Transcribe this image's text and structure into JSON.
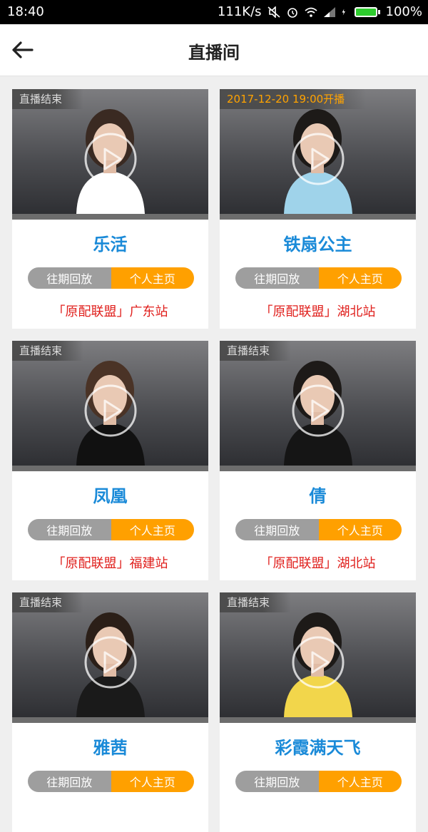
{
  "status_bar": {
    "time": "18:40",
    "speed": "111K/s",
    "battery": "100%"
  },
  "header": {
    "title": "直播间"
  },
  "cards": [
    {
      "status": "直播结束",
      "status_color": "#dddddd",
      "name": "乐活",
      "replay": "往期回放",
      "home": "个人主页",
      "org": "「原配联盟」广东站",
      "outfit": "#ffffff",
      "hair": "#3a2a22"
    },
    {
      "status": "2017-12-20 19:00开播",
      "status_color": "#ffa300",
      "name": "铁扇公主",
      "replay": "往期回放",
      "home": "个人主页",
      "org": "「原配联盟」湖北站",
      "outfit": "#9fd3ea",
      "hair": "#1d1a18"
    },
    {
      "status": "直播结束",
      "status_color": "#dddddd",
      "name": "凤凰",
      "replay": "往期回放",
      "home": "个人主页",
      "org": "「原配联盟」福建站",
      "outfit": "#111111",
      "hair": "#4a3326"
    },
    {
      "status": "直播结束",
      "status_color": "#dddddd",
      "name": "倩",
      "replay": "往期回放",
      "home": "个人主页",
      "org": "「原配联盟」湖北站",
      "outfit": "#151515",
      "hair": "#1d1a18"
    },
    {
      "status": "直播结束",
      "status_color": "#dddddd",
      "name": "雅茜",
      "replay": "往期回放",
      "home": "个人主页",
      "org": "",
      "outfit": "#1a1a1a",
      "hair": "#2b1f18"
    },
    {
      "status": "直播结束",
      "status_color": "#dddddd",
      "name": "彩霞满天飞",
      "replay": "往期回放",
      "home": "个人主页",
      "org": "",
      "outfit": "#f2d64b",
      "hair": "#1d1a18"
    }
  ]
}
